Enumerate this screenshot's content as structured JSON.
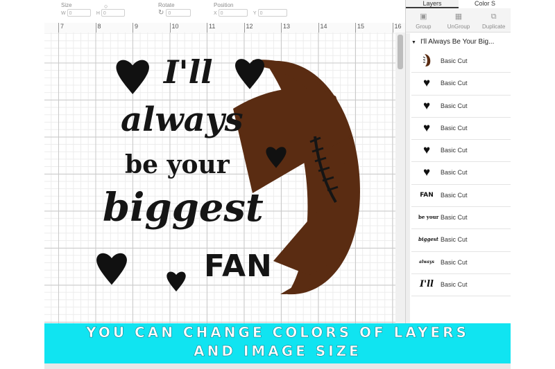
{
  "toolbar": {
    "size_label": "Size",
    "w_label": "W",
    "w_value": "0",
    "h_label": "H",
    "h_value": "0",
    "rotate_label": "Rotate",
    "rotate_value": "0",
    "position_label": "Position",
    "x_label": "X",
    "x_value": "0",
    "y_label": "Y",
    "y_value": "0"
  },
  "ruler": {
    "ticks": [
      "7",
      "8",
      "9",
      "10",
      "11",
      "12",
      "13",
      "14",
      "15",
      "16"
    ]
  },
  "design": {
    "words": [
      "I'll",
      "always",
      "be your",
      "biggest",
      "FAN"
    ],
    "text_color": "#151515",
    "ball_color": "#5a2c12",
    "heart_color": "#111111"
  },
  "panel": {
    "tabs": [
      "Layers",
      "Color S"
    ],
    "tools": [
      {
        "label": "Group",
        "icon": "group-icon"
      },
      {
        "label": "UnGroup",
        "icon": "ungroup-icon"
      },
      {
        "label": "Duplicate",
        "icon": "duplicate-icon"
      }
    ],
    "group_name": "I'll Always Be Your Big...",
    "layers": [
      {
        "name": "Basic Cut",
        "thumb": "football-icon"
      },
      {
        "name": "Basic Cut",
        "thumb": "heart-icon"
      },
      {
        "name": "Basic Cut",
        "thumb": "heart-icon"
      },
      {
        "name": "Basic Cut",
        "thumb": "heart-icon"
      },
      {
        "name": "Basic Cut",
        "thumb": "heart-icon"
      },
      {
        "name": "Basic Cut",
        "thumb": "heart-icon"
      },
      {
        "name": "Basic Cut",
        "thumb_text": "FAN"
      },
      {
        "name": "Basic Cut",
        "thumb_text": "be your"
      },
      {
        "name": "Basic Cut",
        "thumb_text": "biggest"
      },
      {
        "name": "Basic Cut",
        "thumb_text": "always"
      },
      {
        "name": "Basic Cut",
        "thumb_text": "I'll"
      }
    ]
  },
  "banner": {
    "line1": "YOU CAN CHANGE COLORS OF LAYERS",
    "line2": "AND IMAGE SIZE",
    "color": "#10e4f1"
  }
}
